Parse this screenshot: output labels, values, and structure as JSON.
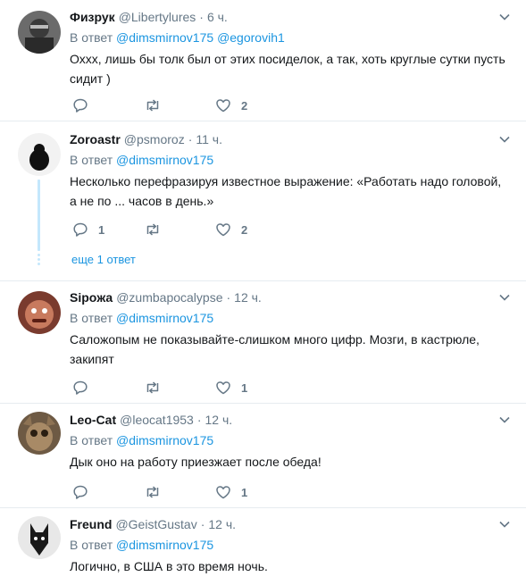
{
  "colors": {
    "link": "#1b95e0",
    "muted": "#657786",
    "text": "#14171a",
    "divider": "#e6ecf0",
    "thread": "#c4e7fc"
  },
  "icons": {
    "reply": "reply-icon",
    "retweet": "retweet-icon",
    "like": "heart-icon",
    "menu": "chevron-down-icon"
  },
  "tweets": [
    {
      "name": "Физрук",
      "handle": "@Libertylures",
      "time": "6 ч.",
      "reply_prefix": "В ответ",
      "mentions": [
        "@dimsmirnov175",
        "@egorovih1"
      ],
      "text": "Оххх, лишь бы толк был от этих посиделок, а так, хоть круглые сутки пусть сидит )",
      "reply_count": "",
      "retweet_count": "",
      "like_count": "2"
    },
    {
      "name": "Zoroastr",
      "handle": "@psmoroz",
      "time": "11 ч.",
      "reply_prefix": "В ответ",
      "mentions": [
        "@dimsmirnov175"
      ],
      "text": "Несколько перефразируя известное выражение: «Работать надо головой, а не по ... часов в день.»",
      "reply_count": "1",
      "retweet_count": "",
      "like_count": "2",
      "more_replies": "еще 1 ответ"
    },
    {
      "name": "Sipoжа",
      "handle": "@zumbapocalypse",
      "time": "12 ч.",
      "reply_prefix": "В ответ",
      "mentions": [
        "@dimsmirnov175"
      ],
      "text": "Салoжопым не показывайте-слишком много цифр. Мозги, в кастрюле, закипят",
      "reply_count": "",
      "retweet_count": "",
      "like_count": "1"
    },
    {
      "name": "Leo-Cat",
      "handle": "@leocat1953",
      "time": "12 ч.",
      "reply_prefix": "В ответ",
      "mentions": [
        "@dimsmirnov175"
      ],
      "text": "Дык оно на работу приезжает после обеда!",
      "reply_count": "",
      "retweet_count": "",
      "like_count": "1"
    },
    {
      "name": "Freund",
      "handle": "@GeistGustav",
      "time": "12 ч.",
      "reply_prefix": "В ответ",
      "mentions": [
        "@dimsmirnov175"
      ],
      "text": "Логично, в США в это время ночь."
    }
  ]
}
